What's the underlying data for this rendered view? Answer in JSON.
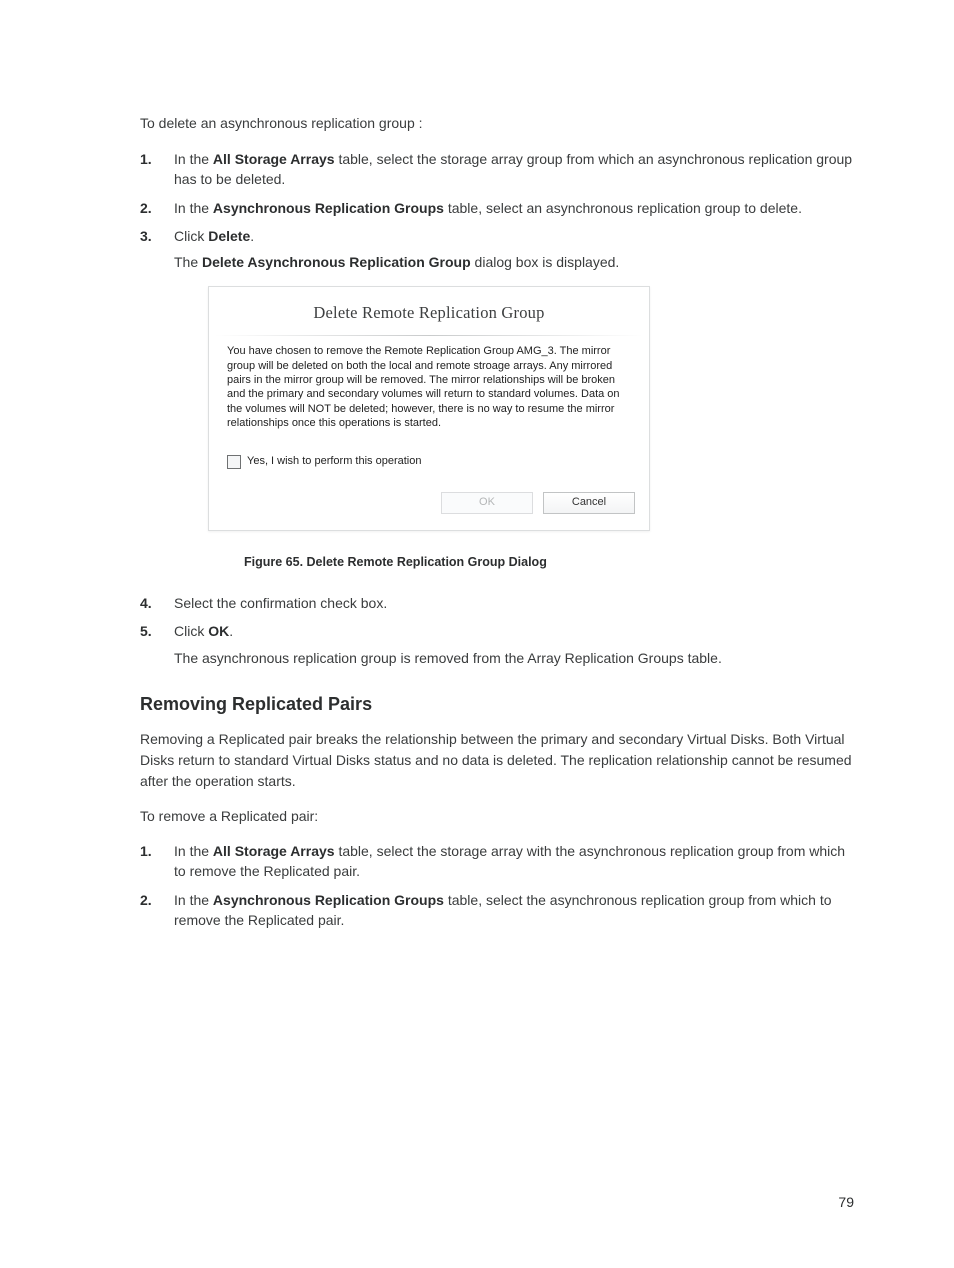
{
  "intro": "To delete an asynchronous replication group :",
  "steps_a": [
    {
      "before": "In the ",
      "bold": "All Storage Arrays",
      "after": " table, select the storage array group from which an asynchronous replication group has to be deleted."
    },
    {
      "before": "In the ",
      "bold": "Asynchronous Replication Groups",
      "after": " table, select an asynchronous replication group to delete."
    },
    {
      "before": "Click ",
      "bold": "Delete",
      "after": ".",
      "sub_before": "The ",
      "sub_bold": "Delete Asynchronous Replication Group",
      "sub_after": " dialog box is displayed."
    }
  ],
  "dialog": {
    "title": "Delete Remote Replication Group",
    "message": "You have chosen to remove the  Remote Replication Group  AMG_3. The mirror group will be deleted on both the local and remote stroage arrays. Any mirrored pairs in the mirror group will be removed. The mirror relationships will be broken and the primary and secondary volumes will return to standard volumes. Data on the volumes will NOT be deleted; however, there is no way to resume the mirror relationships once this operations is started.",
    "checkbox_label": "Yes, I wish to perform this operation",
    "ok_label": "OK",
    "cancel_label": "Cancel"
  },
  "caption": "Figure 65. Delete Remote Replication Group Dialog",
  "steps_b": [
    {
      "text": "Select the confirmation check box."
    },
    {
      "before": "Click ",
      "bold": "OK",
      "after": ".",
      "sub": "The asynchronous replication group is removed from the Array Replication Groups table."
    }
  ],
  "section_heading": "Removing Replicated Pairs",
  "section_p1": "Removing a Replicated pair breaks the relationship between the primary and secondary Virtual Disks. Both Virtual Disks return to standard Virtual Disks status and no data is deleted. The replication relationship cannot be resumed after the operation starts.",
  "section_p2": "To remove a Replicated pair:",
  "steps_c": [
    {
      "before": "In the ",
      "bold": "All Storage Arrays",
      "after": " table, select the storage array with the asynchronous replication group from which to remove the Replicated pair."
    },
    {
      "before": "In the ",
      "bold": "Asynchronous Replication Groups",
      "after": " table, select the asynchronous replication group from which to remove the Replicated pair."
    }
  ],
  "page_number": "79"
}
